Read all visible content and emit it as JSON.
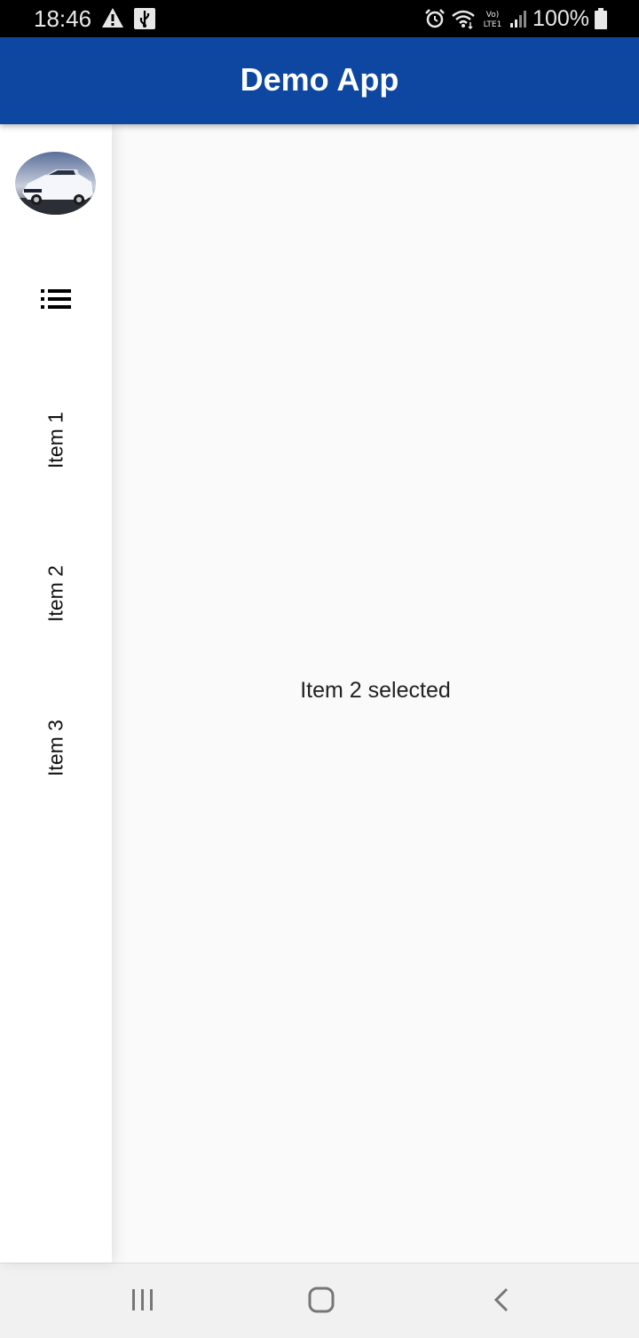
{
  "status_bar": {
    "time": "18:46",
    "battery": "100%",
    "icons": [
      "warning-icon",
      "usb-icon",
      "alarm-icon",
      "wifi-icon",
      "volte-icon",
      "signal-icon",
      "battery-icon"
    ]
  },
  "app_bar": {
    "title": "Demo App",
    "color": "#0d47a1"
  },
  "nav_rail": {
    "avatar": "car-photo",
    "menu_icon": "list-icon",
    "items": [
      {
        "label": "Item 1"
      },
      {
        "label": "Item 2"
      },
      {
        "label": "Item 3"
      }
    ]
  },
  "content": {
    "message": "Item 2 selected"
  },
  "system_nav": {
    "buttons": [
      "recent-apps-icon",
      "home-icon",
      "back-icon"
    ]
  }
}
